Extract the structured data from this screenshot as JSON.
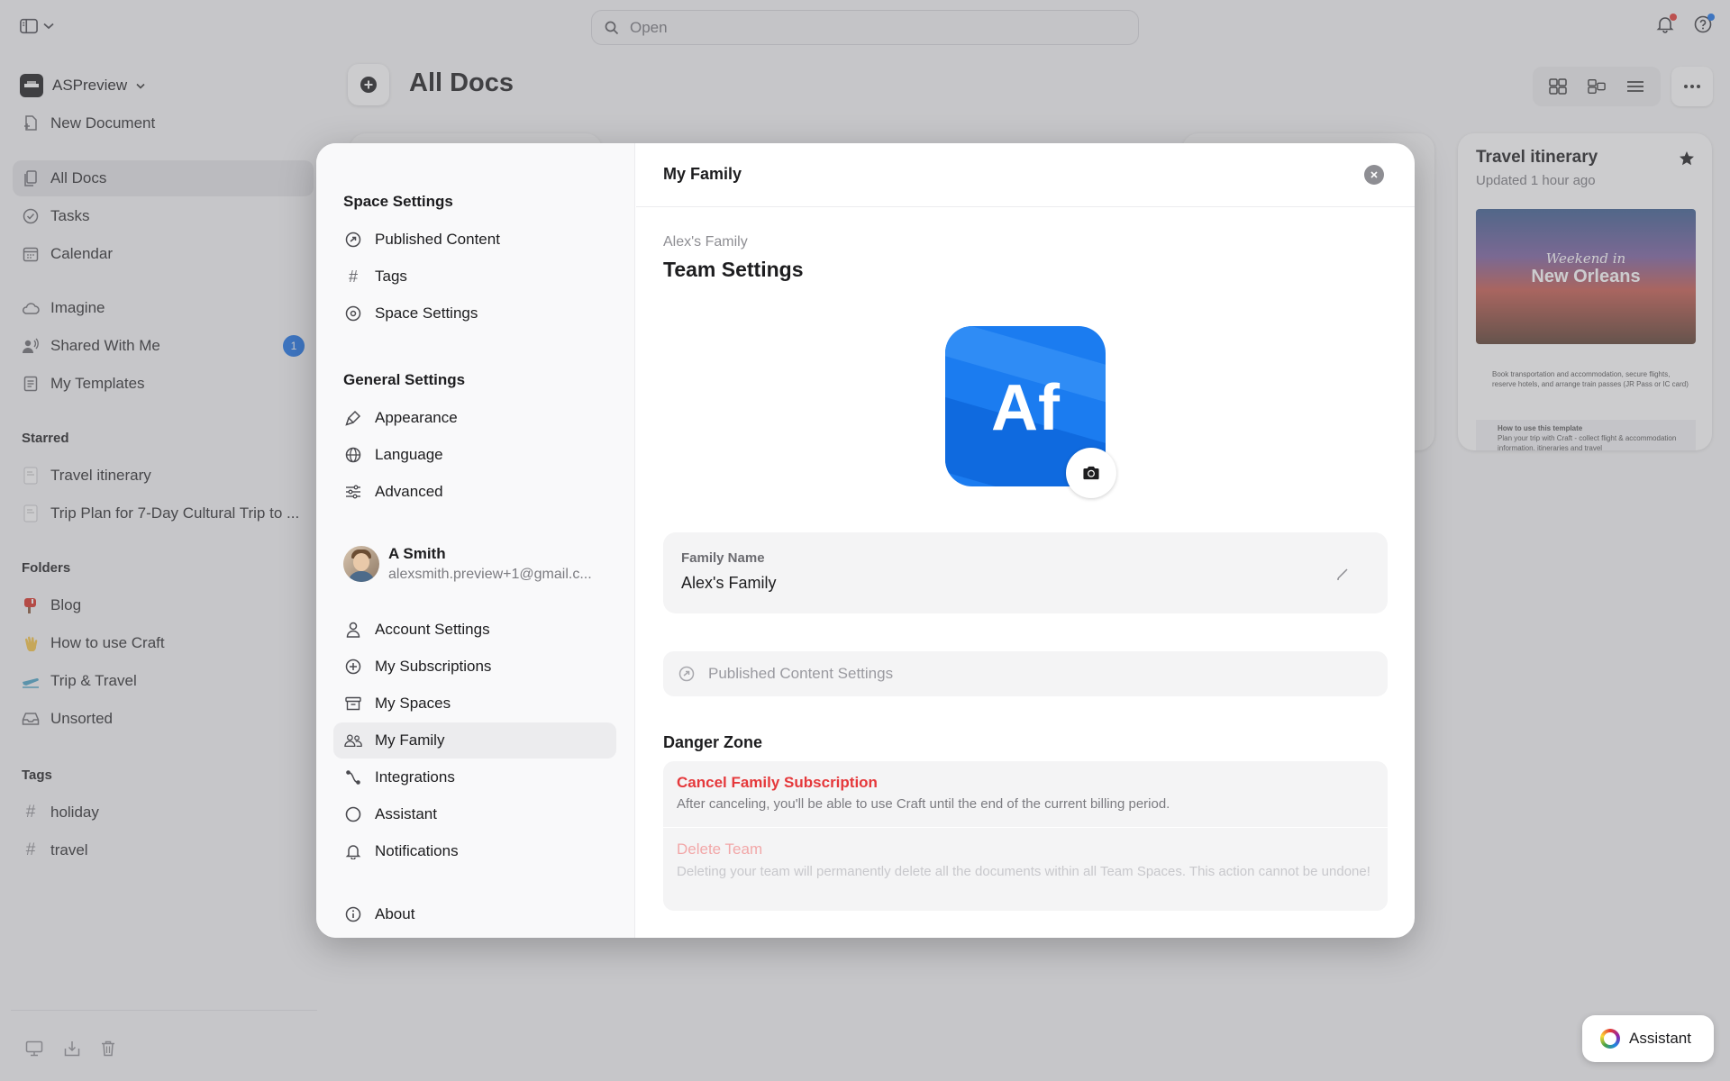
{
  "search": {
    "placeholder": "Open"
  },
  "colors": {
    "accent": "#1a73e8",
    "danger": "#e5383b",
    "bell_dot": "#e53935",
    "help_dot": "#1a73e8"
  },
  "sidebar": {
    "workspace": "ASPreview",
    "new_document": "New Document",
    "nav": [
      {
        "label": "All Docs",
        "icon": "docs-icon"
      },
      {
        "label": "Tasks",
        "icon": "check-circle-icon"
      },
      {
        "label": "Calendar",
        "icon": "calendar-icon"
      },
      {
        "label": "Imagine",
        "icon": "cloud-icon"
      },
      {
        "label": "Shared With Me",
        "icon": "shared-users-icon",
        "badge": "1"
      },
      {
        "label": "My Templates",
        "icon": "template-icon"
      }
    ],
    "starred_heading": "Starred",
    "starred": [
      "Travel itinerary",
      "Trip Plan for 7-Day Cultural Trip to ..."
    ],
    "folders_heading": "Folders",
    "folders": [
      {
        "label": "Blog",
        "icon": "mailbox-icon"
      },
      {
        "label": "How to use Craft",
        "icon": "waving-hand-icon"
      },
      {
        "label": "Trip & Travel",
        "icon": "airplane-icon"
      },
      {
        "label": "Unsorted",
        "icon": "inbox-icon"
      }
    ],
    "tags_heading": "Tags",
    "tags": [
      "holiday",
      "travel"
    ]
  },
  "main": {
    "title": "All Docs",
    "card": {
      "title": "Travel itinerary",
      "updated": "Updated 1 hour ago",
      "image_line1": "Weekend in",
      "image_line2": "New Orleans",
      "text1": "Book transportation and accommodation, secure flights, reserve hotels, and arrange train passes (JR Pass or IC card)",
      "text2_title": "How to use this template",
      "text2_body": "Plan your trip with Craft - collect flight & accommodation information, itineraries and travel"
    }
  },
  "modal": {
    "space_settings_heading": "Space Settings",
    "space_items": [
      {
        "label": "Published Content",
        "icon": "publish-icon"
      },
      {
        "label": "Tags",
        "icon": "hash-icon"
      },
      {
        "label": "Space Settings",
        "icon": "space-gear-icon"
      }
    ],
    "general_heading": "General Settings",
    "general_items": [
      {
        "label": "Appearance",
        "icon": "brush-icon"
      },
      {
        "label": "Language",
        "icon": "globe-icon"
      },
      {
        "label": "Advanced",
        "icon": "sliders-icon"
      }
    ],
    "user": {
      "name": "A Smith",
      "email": "alexsmith.preview+1@gmail.c..."
    },
    "account_items": [
      {
        "label": "Account Settings",
        "icon": "person-icon"
      },
      {
        "label": "My Subscriptions",
        "icon": "subscription-icon"
      },
      {
        "label": "My Spaces",
        "icon": "archive-box-icon"
      },
      {
        "label": "My Family",
        "icon": "family-icon"
      },
      {
        "label": "Integrations",
        "icon": "integration-icon"
      },
      {
        "label": "Assistant",
        "icon": "assistant-circle-icon"
      },
      {
        "label": "Notifications",
        "icon": "bell-icon"
      }
    ],
    "about": "About",
    "title": "My Family",
    "breadcrumb": "Alex's Family",
    "heading": "Team Settings",
    "logo_text": "Af",
    "family_name_label": "Family Name",
    "family_name_value": "Alex's Family",
    "published_settings": "Published Content Settings",
    "danger_zone": "Danger Zone",
    "cancel_title": "Cancel Family Subscription",
    "cancel_desc": "After canceling, you'll be able to use Craft until the end of the current billing period.",
    "delete_title": "Delete Team",
    "delete_desc": "Deleting your team will permanently delete all the documents within all Team Spaces. This action cannot be undone!"
  },
  "assistant_button": "Assistant"
}
